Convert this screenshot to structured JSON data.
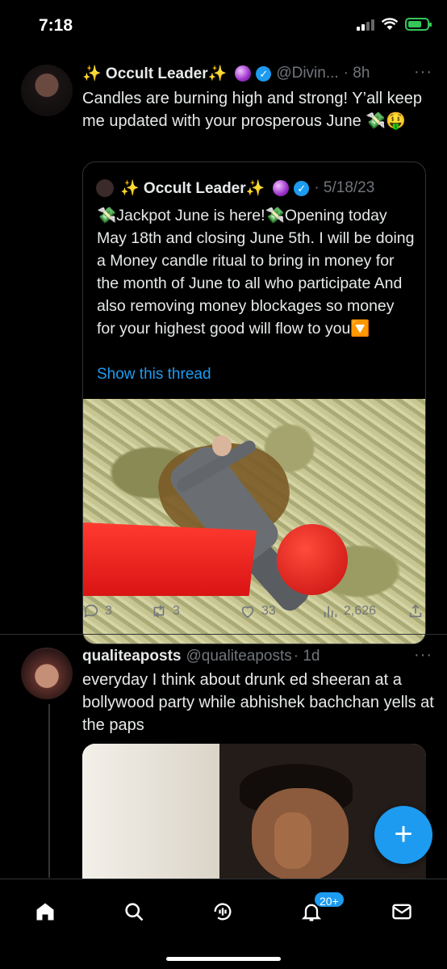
{
  "status_bar": {
    "time": "7:18"
  },
  "tweet1": {
    "author_name": "✨ Occult Leader✨",
    "handle": "@Divin...",
    "time": "· 8h",
    "more": "···",
    "text": "Candles are burning high and strong! Y’all keep me updated with your prosperous June 💸🤑",
    "quote": {
      "author_name": "✨ Occult Leader✨",
      "date": "· 5/18/23",
      "text": "💸Jackpot June is here!💸Opening today May 18th and closing June 5th. I will be doing a Money candle ritual to bring in money for the month of June to all who participate And also removing money blockages so money for your highest good will flow to you🔽",
      "show_thread": "Show this thread"
    },
    "actions": {
      "replies": "3",
      "retweets": "3",
      "likes": "33",
      "views": "2,626"
    }
  },
  "tweet2": {
    "author_name": "qualiteaposts",
    "handle": "@qualiteaposts",
    "time": "· 1d",
    "more": "···",
    "text": "everyday I think about drunk ed sheeran at a bollywood party while abhishek bachchan yells at the paps"
  },
  "fab": {
    "label": "+"
  },
  "bottom_nav": {
    "items": [
      "home-icon",
      "search-icon",
      "spaces-icon",
      "notifications-icon",
      "messages-icon"
    ],
    "notification_badge": "20+"
  },
  "colors": {
    "accent": "#1d9bf0",
    "background": "#000000",
    "muted": "#71767b"
  }
}
